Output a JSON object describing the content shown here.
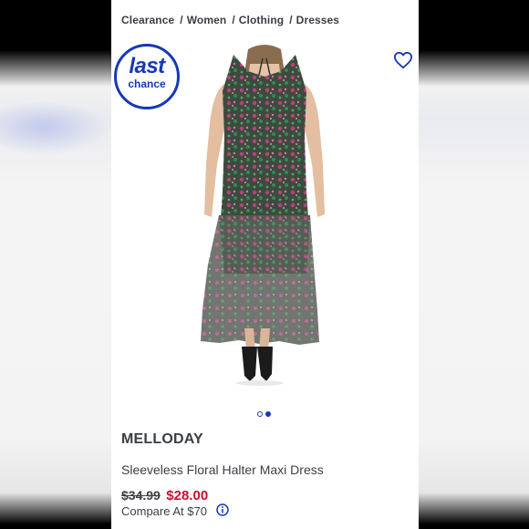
{
  "breadcrumb": {
    "items": [
      "Clearance",
      "Women",
      "Clothing",
      "Dresses"
    ],
    "separator": "/"
  },
  "badge": {
    "line1": "last",
    "line2": "chance",
    "color": "#1639b5"
  },
  "carousel": {
    "total": 2,
    "active": 2
  },
  "product": {
    "brand": "MELLODAY",
    "name": "Sleeveless Floral Halter Maxi Dress",
    "original_price": "$34.99",
    "sale_price": "$28.00",
    "compare_at": "Compare At $70"
  },
  "colors": {
    "accent": "#1639b5",
    "sale": "#c8102e",
    "text": "#3a3e44"
  },
  "icons": [
    "heart-icon",
    "info-icon"
  ]
}
